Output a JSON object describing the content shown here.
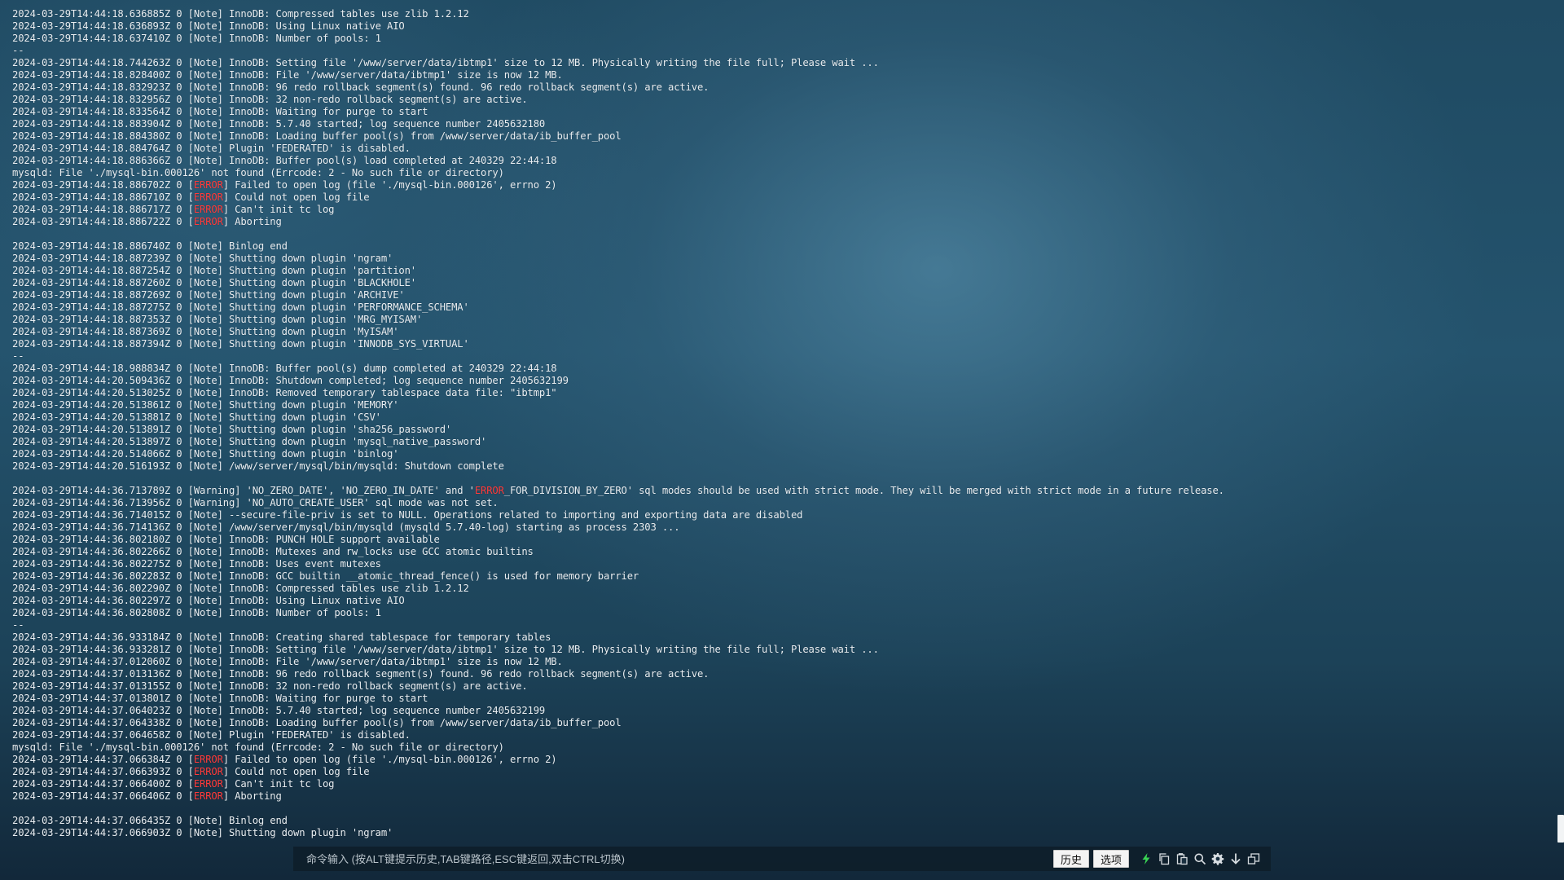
{
  "terminal": {
    "lines": [
      "2024-03-29T14:44:18.636885Z 0 [Note] InnoDB: Compressed tables use zlib 1.2.12",
      "2024-03-29T14:44:18.636893Z 0 [Note] InnoDB: Using Linux native AIO",
      "2024-03-29T14:44:18.637410Z 0 [Note] InnoDB: Number of pools: 1",
      "--",
      "2024-03-29T14:44:18.744263Z 0 [Note] InnoDB: Setting file '/www/server/data/ibtmp1' size to 12 MB. Physically writing the file full; Please wait ...",
      "2024-03-29T14:44:18.828400Z 0 [Note] InnoDB: File '/www/server/data/ibtmp1' size is now 12 MB.",
      "2024-03-29T14:44:18.832923Z 0 [Note] InnoDB: 96 redo rollback segment(s) found. 96 redo rollback segment(s) are active.",
      "2024-03-29T14:44:18.832956Z 0 [Note] InnoDB: 32 non-redo rollback segment(s) are active.",
      "2024-03-29T14:44:18.833564Z 0 [Note] InnoDB: Waiting for purge to start",
      "2024-03-29T14:44:18.883904Z 0 [Note] InnoDB: 5.7.40 started; log sequence number 2405632180",
      "2024-03-29T14:44:18.884380Z 0 [Note] InnoDB: Loading buffer pool(s) from /www/server/data/ib_buffer_pool",
      "2024-03-29T14:44:18.884764Z 0 [Note] Plugin 'FEDERATED' is disabled.",
      "2024-03-29T14:44:18.886366Z 0 [Note] InnoDB: Buffer pool(s) load completed at 240329 22:44:18",
      "mysqld: File './mysql-bin.000126' not found (Errcode: 2 - No such file or directory)",
      "2024-03-29T14:44:18.886702Z 0 [ERROR] Failed to open log (file './mysql-bin.000126', errno 2)",
      "2024-03-29T14:44:18.886710Z 0 [ERROR] Could not open log file",
      "2024-03-29T14:44:18.886717Z 0 [ERROR] Can't init tc log",
      "2024-03-29T14:44:18.886722Z 0 [ERROR] Aborting",
      "",
      "2024-03-29T14:44:18.886740Z 0 [Note] Binlog end",
      "2024-03-29T14:44:18.887239Z 0 [Note] Shutting down plugin 'ngram'",
      "2024-03-29T14:44:18.887254Z 0 [Note] Shutting down plugin 'partition'",
      "2024-03-29T14:44:18.887260Z 0 [Note] Shutting down plugin 'BLACKHOLE'",
      "2024-03-29T14:44:18.887269Z 0 [Note] Shutting down plugin 'ARCHIVE'",
      "2024-03-29T14:44:18.887275Z 0 [Note] Shutting down plugin 'PERFORMANCE_SCHEMA'",
      "2024-03-29T14:44:18.887353Z 0 [Note] Shutting down plugin 'MRG_MYISAM'",
      "2024-03-29T14:44:18.887369Z 0 [Note] Shutting down plugin 'MyISAM'",
      "2024-03-29T14:44:18.887394Z 0 [Note] Shutting down plugin 'INNODB_SYS_VIRTUAL'",
      "--",
      "2024-03-29T14:44:18.988834Z 0 [Note] InnoDB: Buffer pool(s) dump completed at 240329 22:44:18",
      "2024-03-29T14:44:20.509436Z 0 [Note] InnoDB: Shutdown completed; log sequence number 2405632199",
      "2024-03-29T14:44:20.513025Z 0 [Note] InnoDB: Removed temporary tablespace data file: \"ibtmp1\"",
      "2024-03-29T14:44:20.513861Z 0 [Note] Shutting down plugin 'MEMORY'",
      "2024-03-29T14:44:20.513881Z 0 [Note] Shutting down plugin 'CSV'",
      "2024-03-29T14:44:20.513891Z 0 [Note] Shutting down plugin 'sha256_password'",
      "2024-03-29T14:44:20.513897Z 0 [Note] Shutting down plugin 'mysql_native_password'",
      "2024-03-29T14:44:20.514066Z 0 [Note] Shutting down plugin 'binlog'",
      "2024-03-29T14:44:20.516193Z 0 [Note] /www/server/mysql/bin/mysqld: Shutdown complete",
      "",
      "2024-03-29T14:44:36.713789Z 0 [Warning] 'NO_ZERO_DATE', 'NO_ZERO_IN_DATE' and 'ERROR_FOR_DIVISION_BY_ZERO' sql modes should be used with strict mode. They will be merged with strict mode in a future release.",
      "2024-03-29T14:44:36.713956Z 0 [Warning] 'NO_AUTO_CREATE_USER' sql mode was not set.",
      "2024-03-29T14:44:36.714015Z 0 [Note] --secure-file-priv is set to NULL. Operations related to importing and exporting data are disabled",
      "2024-03-29T14:44:36.714136Z 0 [Note] /www/server/mysql/bin/mysqld (mysqld 5.7.40-log) starting as process 2303 ...",
      "2024-03-29T14:44:36.802180Z 0 [Note] InnoDB: PUNCH HOLE support available",
      "2024-03-29T14:44:36.802266Z 0 [Note] InnoDB: Mutexes and rw_locks use GCC atomic builtins",
      "2024-03-29T14:44:36.802275Z 0 [Note] InnoDB: Uses event mutexes",
      "2024-03-29T14:44:36.802283Z 0 [Note] InnoDB: GCC builtin __atomic_thread_fence() is used for memory barrier",
      "2024-03-29T14:44:36.802290Z 0 [Note] InnoDB: Compressed tables use zlib 1.2.12",
      "2024-03-29T14:44:36.802297Z 0 [Note] InnoDB: Using Linux native AIO",
      "2024-03-29T14:44:36.802808Z 0 [Note] InnoDB: Number of pools: 1",
      "--",
      "2024-03-29T14:44:36.933184Z 0 [Note] InnoDB: Creating shared tablespace for temporary tables",
      "2024-03-29T14:44:36.933281Z 0 [Note] InnoDB: Setting file '/www/server/data/ibtmp1' size to 12 MB. Physically writing the file full; Please wait ...",
      "2024-03-29T14:44:37.012060Z 0 [Note] InnoDB: File '/www/server/data/ibtmp1' size is now 12 MB.",
      "2024-03-29T14:44:37.013136Z 0 [Note] InnoDB: 96 redo rollback segment(s) found. 96 redo rollback segment(s) are active.",
      "2024-03-29T14:44:37.013155Z 0 [Note] InnoDB: 32 non-redo rollback segment(s) are active.",
      "2024-03-29T14:44:37.013801Z 0 [Note] InnoDB: Waiting for purge to start",
      "2024-03-29T14:44:37.064023Z 0 [Note] InnoDB: 5.7.40 started; log sequence number 2405632199",
      "2024-03-29T14:44:37.064338Z 0 [Note] InnoDB: Loading buffer pool(s) from /www/server/data/ib_buffer_pool",
      "2024-03-29T14:44:37.064658Z 0 [Note] Plugin 'FEDERATED' is disabled.",
      "mysqld: File './mysql-bin.000126' not found (Errcode: 2 - No such file or directory)",
      "2024-03-29T14:44:37.066384Z 0 [ERROR] Failed to open log (file './mysql-bin.000126', errno 2)",
      "2024-03-29T14:44:37.066393Z 0 [ERROR] Could not open log file",
      "2024-03-29T14:44:37.066400Z 0 [ERROR] Can't init tc log",
      "2024-03-29T14:44:37.066406Z 0 [ERROR] Aborting",
      "",
      "2024-03-29T14:44:37.066435Z 0 [Note] Binlog end",
      "2024-03-29T14:44:37.066903Z 0 [Note] Shutting down plugin 'ngram'"
    ],
    "highlight_word": "ERROR",
    "highlight_color": "#ff3b3b",
    "text_color": "#e9eef2"
  },
  "command_bar": {
    "placeholder": "命令输入 (按ALT键提示历史,TAB键路径,ESC键返回,双击CTRL切换)",
    "history_label": "历史",
    "options_label": "选项",
    "icons": [
      "lightning-icon",
      "copy-icon",
      "paste-icon",
      "search-icon",
      "gear-icon",
      "download-icon",
      "window-icon"
    ],
    "lightning_color": "#39d353"
  }
}
